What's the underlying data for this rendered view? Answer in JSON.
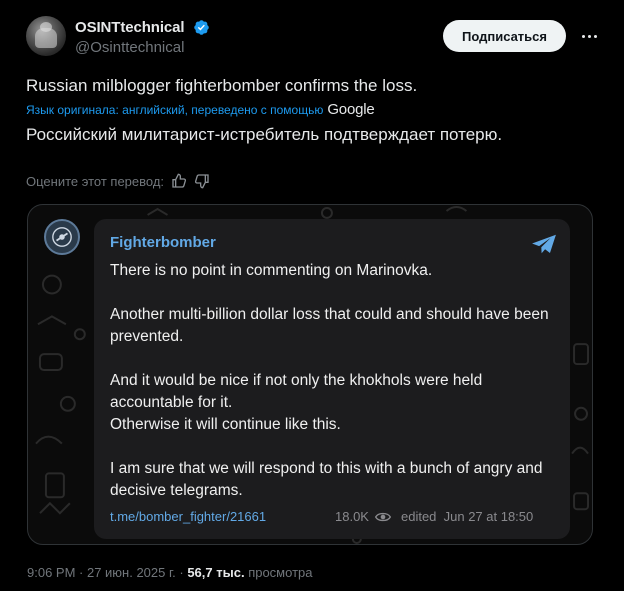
{
  "author": {
    "name": "OSINTtechnical",
    "handle": "@Osinttechnical",
    "verified": true
  },
  "follow_label": "Подписаться",
  "tweet": {
    "original_text": "Russian milblogger fighterbomber confirms the loss.",
    "translation_note": "Язык оригинала: английский, переведено с помощью",
    "translation_provider": "Google",
    "translated_text": "Российский милитарист-истребитель подтверждает потерю.",
    "rate_label": "Оцените этот перевод:"
  },
  "telegram_post": {
    "channel": "Fighterbomber",
    "paragraphs": [
      "There is no point in commenting on Marinovka.",
      "Another multi-billion dollar loss that could and should have been prevented.",
      "And it would be nice if not only the khokhols were held accountable for it.\nOtherwise it will continue like this.",
      "I am sure that we will respond to this with a bunch of angry and decisive telegrams."
    ],
    "link": "t.me/bomber_fighter/21661",
    "views": "18.0K",
    "edited": "edited  Jun 27 at 18:50"
  },
  "footer": {
    "timestamp": "9:06 PM · 27 июн. 2025 г. ·",
    "views_count": "56,7 тыс.",
    "views_label": "просмотра"
  },
  "colors": {
    "background": "#000000",
    "accent": "#1d9bf0",
    "telegram_blue": "#62a9e6",
    "muted": "#71767b"
  }
}
